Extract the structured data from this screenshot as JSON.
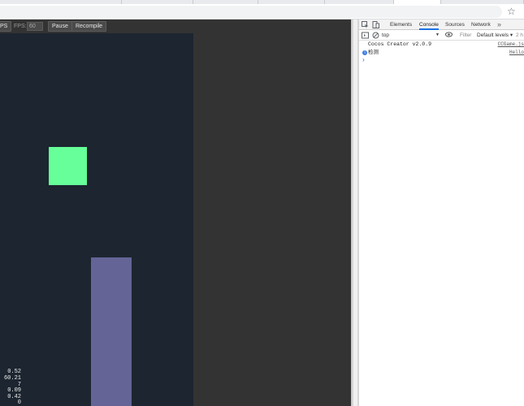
{
  "browser": {
    "toolbar": {
      "bookmark_icon": "star-icon",
      "bookmark_glyph": "☆"
    }
  },
  "preview": {
    "toolbar": {
      "stats_button_label": "PS",
      "fps_label": "FPS:",
      "fps_value": "60",
      "pause_label": "Pause",
      "recompile_label": "Recompile"
    },
    "canvas": {
      "background": "#1c2530",
      "green_block_color": "#66ff99",
      "purple_block_color": "#646496"
    },
    "stats": [
      "0.52",
      "60.21",
      "7",
      "0.09",
      "0.42",
      "0"
    ]
  },
  "devtools": {
    "tabs": [
      {
        "label": "Elements"
      },
      {
        "label": "Console",
        "active": true
      },
      {
        "label": "Sources"
      },
      {
        "label": "Network"
      }
    ],
    "more_tabs_glyph": "»",
    "context": "top",
    "filter_placeholder": "Filter",
    "levels": "Default levels ▾",
    "hidden_count": "2 h",
    "console_lines": [
      {
        "message": "Cocos Creator v2.0.9",
        "source": "CCGame.js"
      },
      {
        "message": "检测",
        "source": "Hello",
        "info": true
      }
    ],
    "prompt_glyph": "›"
  }
}
